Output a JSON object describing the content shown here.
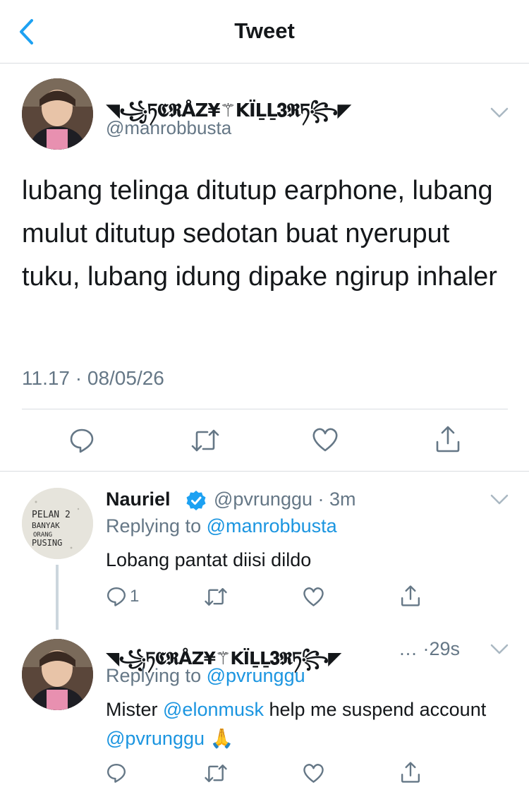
{
  "header": {
    "title": "Tweet",
    "back_icon": "chevron-left-icon"
  },
  "main_tweet": {
    "display_name": "◥꧁ཏ𝕮𝕽ÅZ¥⚚KÏḺḺ𝟑𝕽ཏ꧂◤",
    "handle": "@manrobbusta",
    "text": "lubang telinga ditutup earphone, lubang mulut ditutup sedotan buat nyeruput tuku, lubang idung dipake ngirup inhaler",
    "timestamp": "11.17 · 08/05/26",
    "actions": [
      "reply-icon",
      "retweet-icon",
      "like-icon",
      "share-icon"
    ]
  },
  "reply1": {
    "display_name": "Nauriel",
    "handle": "@pvrunggu",
    "time": "3m",
    "replying_prefix": "Replying to",
    "replying_to": "@manrobbusta",
    "text": "Lobang pantat diisi dildo",
    "reply_count": "1",
    "avatar_text": [
      "PELAN 2",
      "BANYAK",
      "ORANG",
      "PUSING"
    ]
  },
  "reply2": {
    "display_name": "◥꧁ཏ𝕮𝕽ÅZ¥⚚KÏḺḺ𝟑𝕽ཏ꧂◤",
    "ellipsis": "…",
    "time": "29s",
    "replying_prefix": "Replying to",
    "replying_to": "@pvrunggu",
    "text_1": "Mister",
    "mention_1": "@elonmusk",
    "text_2": "help me suspend account",
    "mention_2": "@pvrunggu",
    "emoji": "🙏"
  },
  "colors": {
    "link": "#1b95e0",
    "secondary": "#657786",
    "verified": "#1da1f2",
    "divider": "#d9dde1"
  }
}
